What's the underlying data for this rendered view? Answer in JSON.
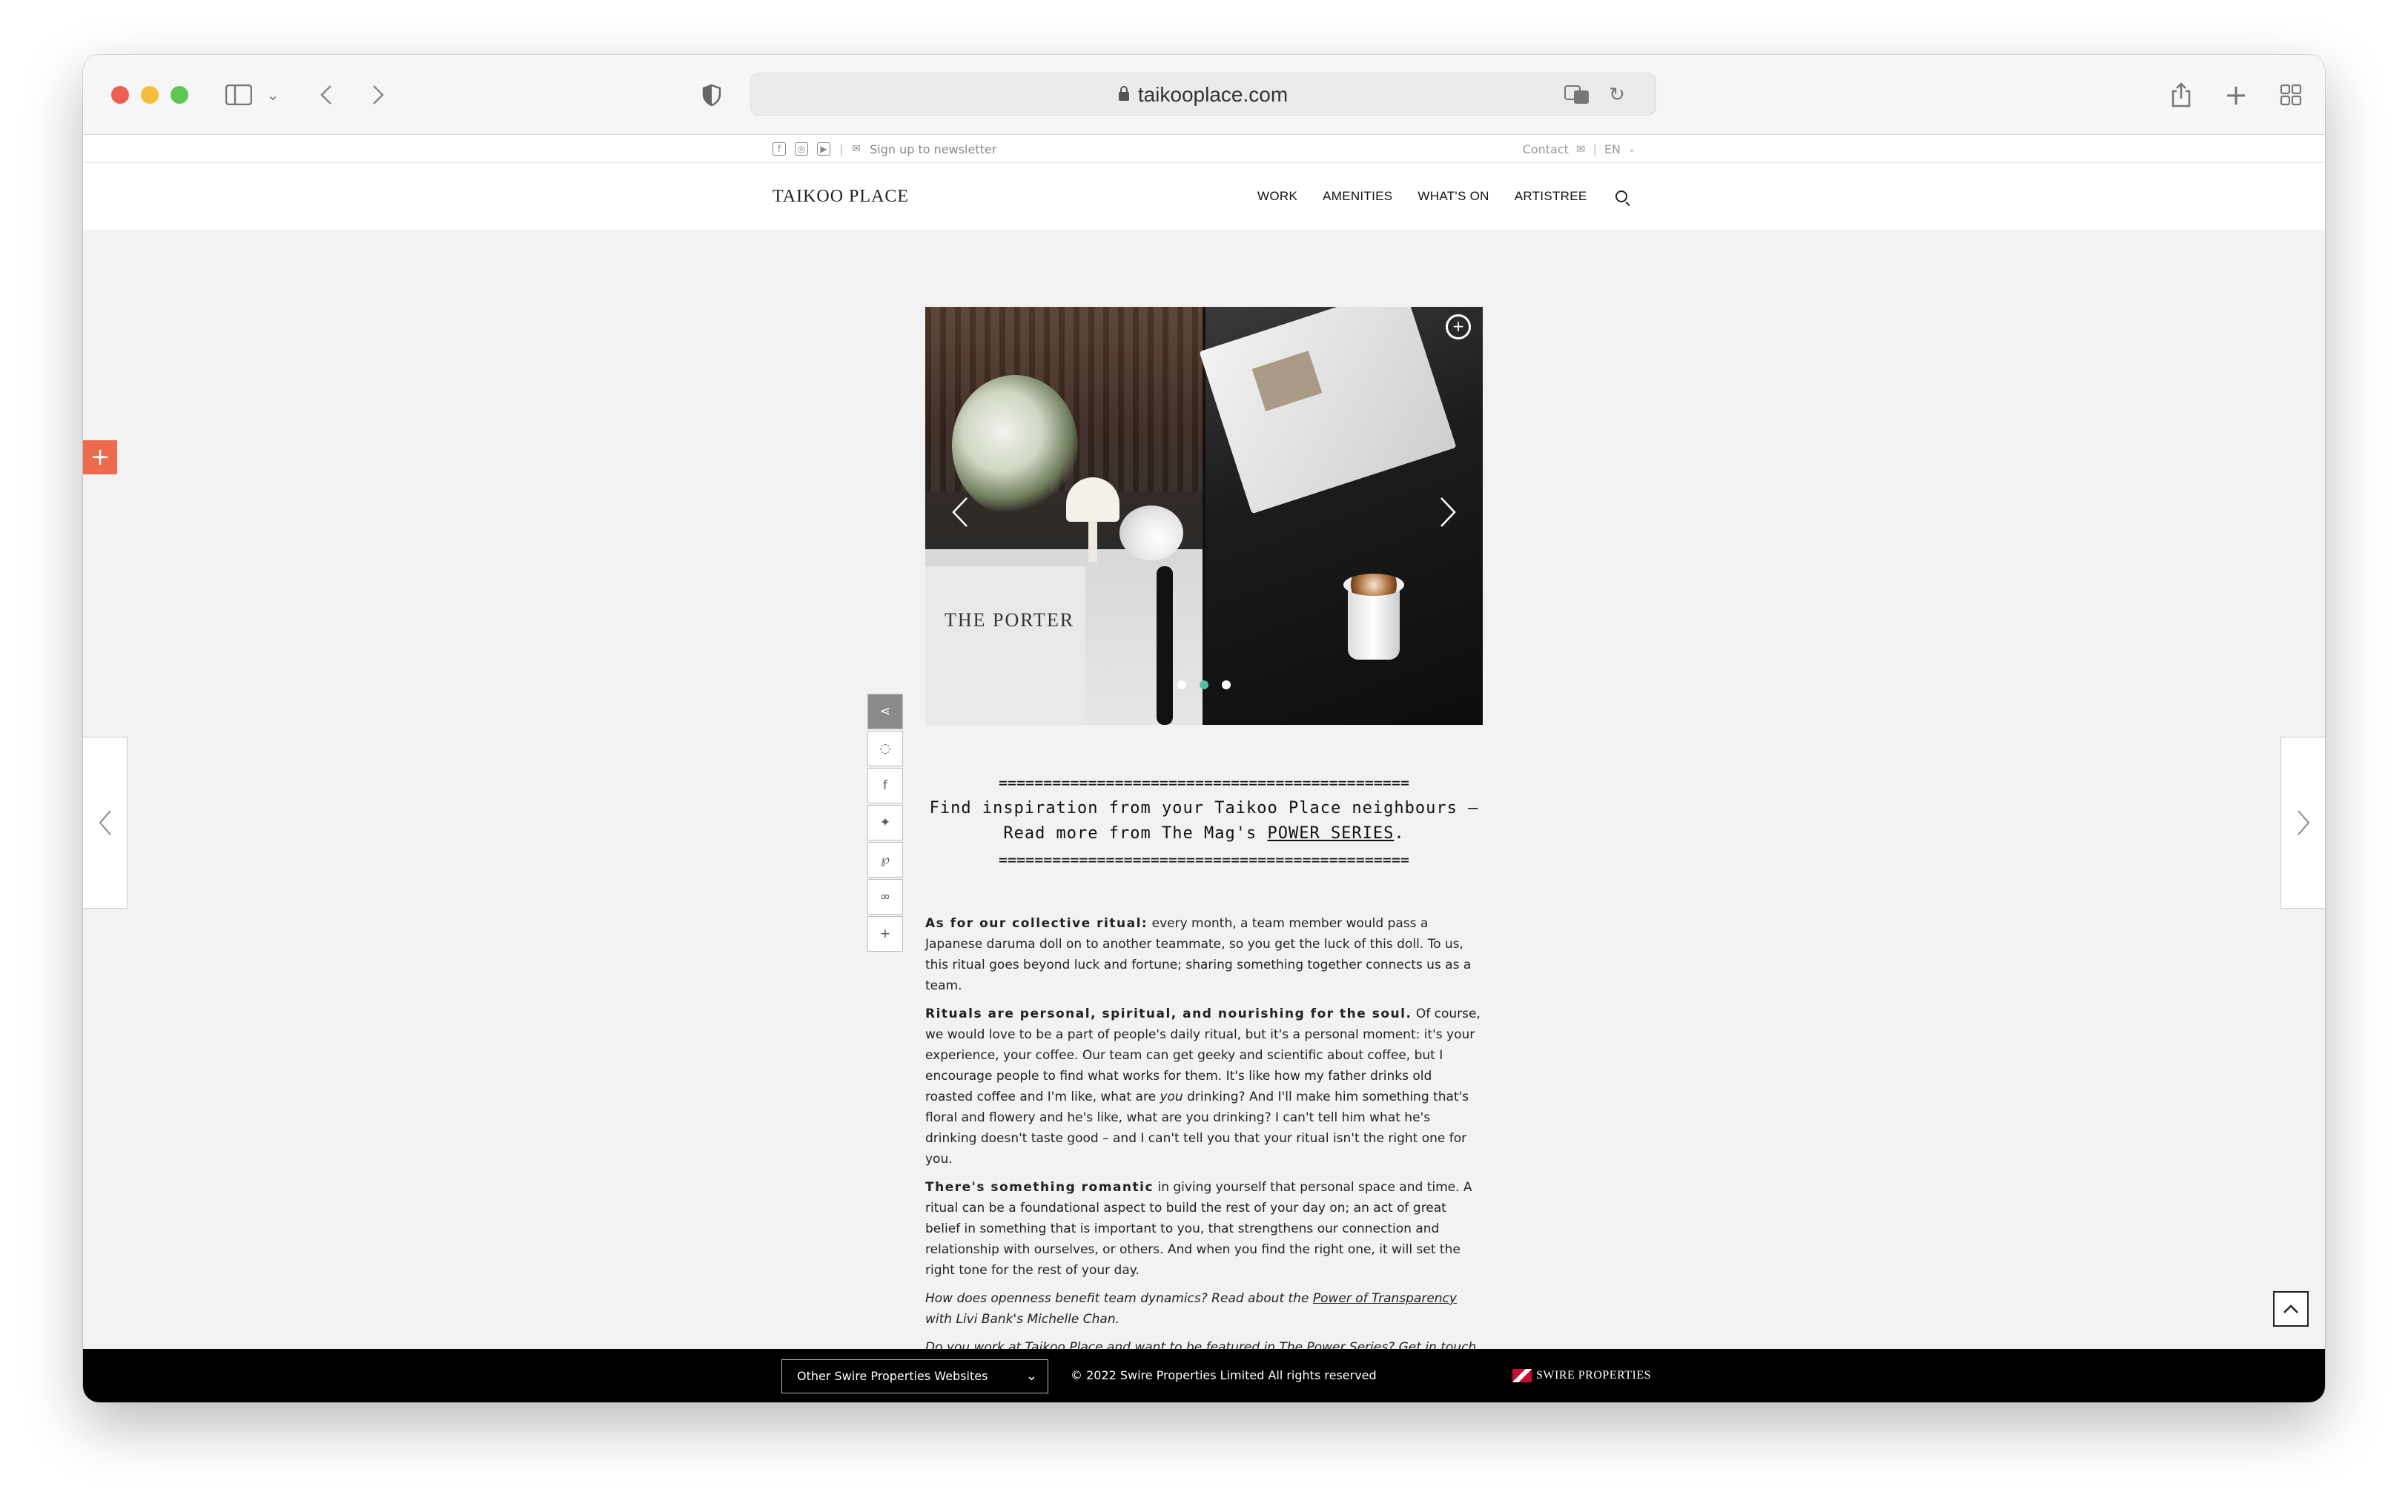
{
  "browser": {
    "url": "taikooplace.com"
  },
  "utility": {
    "newsletter": "Sign up to newsletter",
    "contact": "Contact",
    "lang": "EN"
  },
  "nav": {
    "logo": "TAIKOO PLACE",
    "items": [
      "WORK",
      "AMENITIES",
      "WHAT'S ON",
      "ARTISTREE"
    ]
  },
  "gallery": {
    "left_sign": "THE PORTER",
    "slide_count": 3,
    "active_slide": 2
  },
  "callout": {
    "rule": "==============================================",
    "line1": "Find inspiration from your Taikoo Place neighbours –",
    "line2_prefix": "Read more from The Mag's ",
    "line2_link": "POWER SERIES",
    "line2_suffix": "."
  },
  "article": {
    "p1_bold": "As for our collective ritual:",
    "p1_text": " every month, a team member would pass a Japanese daruma doll on to another teammate, so you get the luck of this doll. To us, this ritual goes beyond luck and fortune; sharing something together connects us as a team.",
    "p2_bold": "Rituals are personal, spiritual, and nourishing for the soul.",
    "p2_text_a": " Of course, we would love to be a part of people's daily ritual, but it's a personal moment: it's your experience, your coffee. Our team can get geeky and scientific about coffee, but I encourage people to find what works for them. It's like how my father drinks old roasted coffee and I'm like, what are ",
    "p2_italic": "you",
    "p2_text_b": " drinking? And I'll make him something that's floral and flowery and he's like, what are you drinking? I can't tell him what he's drinking doesn't taste good – and I can't tell you that your ritual isn't the right one for you.",
    "p3_bold": "There's something romantic",
    "p3_text": " in giving yourself that personal space and time. A ritual can be a foundational aspect to build the rest of your day on; an act of great belief in something that is important to you, that strengthens our connection and relationship with ourselves, or others. And when you find the right one, it will set the right tone for the rest of your day.",
    "p4_text": "How does openness benefit team dynamics? Read about the ",
    "p4_link": "Power of Transparency",
    "p4_suffix": " with Livi Bank's Michelle Chan.",
    "p5_text": "Do you work at Taikoo Place and want to be featured in The Power Series? ",
    "p5_link": "Get in touch",
    "p5_suffix": "."
  },
  "footer": {
    "select_label": "Other Swire Properties Websites",
    "copyright": "© 2022 Swire Properties Limited All rights reserved",
    "brand": "SWIRE PROPERTIES"
  },
  "icons": {
    "share": "share-icon",
    "whatsapp": "whatsapp-icon",
    "facebook": "facebook-icon",
    "twitter": "twitter-icon",
    "pinterest": "pinterest-icon",
    "link": "link-icon",
    "more": "plus-icon"
  },
  "colors": {
    "accent_orange": "#ee6a4c",
    "active_dot": "#4fc3a1",
    "footer_bg": "#000000"
  }
}
